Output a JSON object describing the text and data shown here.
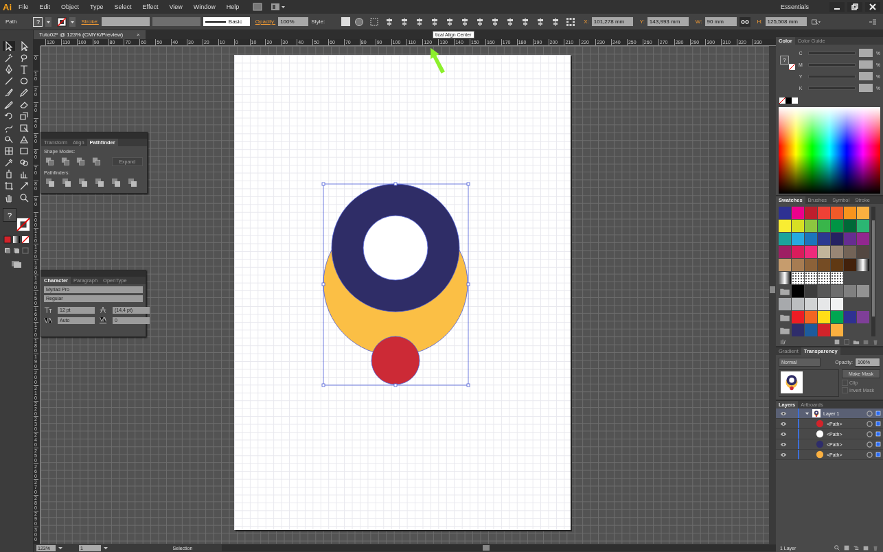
{
  "app": {
    "logo": "Ai",
    "menus": [
      "File",
      "Edit",
      "Object",
      "Type",
      "Select",
      "Effect",
      "View",
      "Window",
      "Help"
    ],
    "workspace": "Essentials"
  },
  "control_bar": {
    "selection": "Path",
    "fill_label": "?",
    "stroke_label": "Stroke:",
    "brush": "Basic",
    "opacity_label": "Opacity:",
    "opacity": "100%",
    "style_label": "Style:",
    "x_label": "X:",
    "x": "101,278 mm",
    "y_label": "Y:",
    "y": "143,993 mm",
    "w_label": "W:",
    "w": "90 mm",
    "h_label": "H:",
    "h": "125,508 mm"
  },
  "document_tab": {
    "title": "Tuto02* @ 123% (CMYK/Preview)",
    "close": "×"
  },
  "rulers": {
    "horizontal": [
      "120",
      "110",
      "100",
      "90",
      "80",
      "70",
      "60",
      "50",
      "40",
      "30",
      "20",
      "10",
      "0",
      "10",
      "20",
      "30",
      "40",
      "50",
      "60",
      "70",
      "80",
      "90",
      "100",
      "110",
      "120",
      "130",
      "140",
      "150",
      "160",
      "170",
      "180",
      "190",
      "200",
      "210",
      "220",
      "230",
      "240",
      "250",
      "260",
      "270",
      "280",
      "290",
      "300",
      "310",
      "320",
      "330"
    ],
    "vertical": [
      "0",
      "10",
      "20",
      "30",
      "40",
      "50",
      "60",
      "70",
      "80",
      "90",
      "100",
      "110",
      "120",
      "130",
      "140",
      "150",
      "160",
      "170",
      "180",
      "190",
      "200",
      "210",
      "220",
      "230",
      "240",
      "250",
      "260",
      "270",
      "280",
      "290",
      "300"
    ]
  },
  "tooltip": "tical Align Center",
  "toolbar": {
    "fill_label": "?"
  },
  "pathfinder_panel": {
    "tabs": [
      {
        "label": "Transform",
        "selected": false
      },
      {
        "label": "Align",
        "selected": false
      },
      {
        "label": "Pathfinder",
        "selected": true
      }
    ],
    "shape_modes_label": "Shape Modes:",
    "expand_button": {
      "label": "Expand",
      "disabled": true
    },
    "pathfinders_label": "Pathfinders:"
  },
  "character_panel": {
    "tabs": [
      {
        "label": "Character",
        "selected": true
      },
      {
        "label": "Paragraph",
        "selected": false
      },
      {
        "label": "OpenType",
        "selected": false
      }
    ],
    "font": "Myriad Pro",
    "style": "Regular",
    "size": "12 pt",
    "leading": "(14,4 pt)",
    "kerning": "Auto",
    "tracking": "0"
  },
  "color_panel": {
    "tabs": [
      {
        "label": "Color",
        "selected": true
      },
      {
        "label": "Color Guide",
        "selected": false
      }
    ],
    "fill_label": "?",
    "channels": [
      {
        "name": "C",
        "unit": "%",
        "level": 0
      },
      {
        "name": "M",
        "unit": "%",
        "level": 0
      },
      {
        "name": "Y",
        "unit": "%",
        "level": 0
      },
      {
        "name": "K",
        "unit": "%",
        "level": 0
      }
    ]
  },
  "swatches_panel": {
    "tabs": [
      {
        "label": "Swatches",
        "selected": true
      },
      {
        "label": "Brushes",
        "selected": false
      },
      {
        "label": "Symbol",
        "selected": false
      },
      {
        "label": "Stroke",
        "selected": false
      }
    ],
    "rows": [
      [
        {
          "kind": "color",
          "color": "#2e3192"
        },
        {
          "kind": "color",
          "color": "#ec008c"
        },
        {
          "kind": "color",
          "color": "#be1e2d"
        },
        {
          "kind": "color",
          "color": "#ef4136"
        },
        {
          "kind": "color",
          "color": "#f15a29"
        },
        {
          "kind": "color",
          "color": "#f7941d"
        },
        {
          "kind": "color",
          "color": "#fbb040"
        }
      ],
      [
        {
          "kind": "color",
          "color": "#f9ed32"
        },
        {
          "kind": "color",
          "color": "#d7df23"
        },
        {
          "kind": "color",
          "color": "#8dc63f"
        },
        {
          "kind": "color",
          "color": "#39b54a"
        },
        {
          "kind": "color",
          "color": "#009444"
        },
        {
          "kind": "color",
          "color": "#006838"
        },
        {
          "kind": "color",
          "color": "#2bb673"
        }
      ],
      [
        {
          "kind": "color",
          "color": "#1ba39c"
        },
        {
          "kind": "color",
          "color": "#27aae1"
        },
        {
          "kind": "color",
          "color": "#1c75bc"
        },
        {
          "kind": "color",
          "color": "#2b3990"
        },
        {
          "kind": "color",
          "color": "#262262"
        },
        {
          "kind": "color",
          "color": "#662d91"
        },
        {
          "kind": "color",
          "color": "#92278f"
        }
      ],
      [
        {
          "kind": "color",
          "color": "#9e1f63"
        },
        {
          "kind": "color",
          "color": "#da1c5c"
        },
        {
          "kind": "color",
          "color": "#ee2a7b"
        },
        {
          "kind": "color",
          "color": "#c2b59b"
        },
        {
          "kind": "color",
          "color": "#998675"
        },
        {
          "kind": "color",
          "color": "#736357"
        },
        {
          "kind": "color",
          "color": "#534741"
        }
      ],
      [
        {
          "kind": "color",
          "color": "#c69c6d"
        },
        {
          "kind": "color",
          "color": "#a67c52"
        },
        {
          "kind": "color",
          "color": "#8c6239"
        },
        {
          "kind": "color",
          "color": "#754c24"
        },
        {
          "kind": "color",
          "color": "#603913"
        },
        {
          "kind": "color",
          "color": "#42210b"
        },
        {
          "kind": "gradient"
        }
      ],
      [
        {
          "kind": "gradient"
        },
        {
          "kind": "pattern"
        },
        {
          "kind": "pattern"
        },
        {
          "kind": "pattern"
        },
        {
          "kind": "pattern"
        }
      ],
      [
        {
          "kind": "folder"
        },
        {
          "kind": "color",
          "color": "#000000"
        },
        {
          "kind": "color",
          "color": "#3c3c3c"
        },
        {
          "kind": "color",
          "color": "#575757"
        },
        {
          "kind": "color",
          "color": "#6d6d6d"
        },
        {
          "kind": "color",
          "color": "#808080"
        },
        {
          "kind": "color",
          "color": "#939393"
        }
      ],
      [
        {
          "kind": "color",
          "color": "#a7a9ac"
        },
        {
          "kind": "color",
          "color": "#bcbec0"
        },
        {
          "kind": "color",
          "color": "#d1d3d4"
        },
        {
          "kind": "color",
          "color": "#e6e7e8"
        },
        {
          "kind": "color",
          "color": "#f1f2f2"
        }
      ],
      [
        {
          "kind": "folder"
        },
        {
          "kind": "color",
          "color": "#ed1c24"
        },
        {
          "kind": "color",
          "color": "#f26522"
        },
        {
          "kind": "color",
          "color": "#ffde17"
        },
        {
          "kind": "color",
          "color": "#00a651"
        },
        {
          "kind": "color",
          "color": "#2e3192"
        },
        {
          "kind": "color",
          "color": "#7f3f98"
        }
      ],
      [
        {
          "kind": "folder"
        },
        {
          "kind": "color",
          "color": "#2e2d6b"
        },
        {
          "kind": "color",
          "color": "#1d5b9c"
        },
        {
          "kind": "color",
          "color": "#d2232a"
        },
        {
          "kind": "color",
          "color": "#fbb040"
        }
      ]
    ]
  },
  "transparency_panel": {
    "tabs": [
      {
        "label": "Gradient",
        "selected": false
      },
      {
        "label": "Transparency",
        "selected": true
      }
    ],
    "blend_mode": "Normal",
    "opacity_label": "Opacity:",
    "opacity": "100%",
    "make_mask": "Make Mask",
    "options": [
      {
        "label": "Clip",
        "checked": false
      },
      {
        "label": "Invert Mask",
        "checked": false
      }
    ]
  },
  "layers_panel": {
    "tabs": [
      {
        "label": "Layers",
        "selected": true
      },
      {
        "label": "Artboards",
        "selected": false
      }
    ],
    "layers": [
      {
        "name": "Layer 1",
        "expanded": true,
        "selected": true,
        "children": [
          {
            "name": "<Path>",
            "color": "#d2232a",
            "selected": false
          },
          {
            "name": "<Path>",
            "color": "#ffffff",
            "selected": false
          },
          {
            "name": "<Path>",
            "color": "#2e2d6b",
            "selected": false
          },
          {
            "name": "<Path>",
            "color": "#fbb040",
            "selected": false
          }
        ]
      }
    ]
  },
  "status_bar": {
    "zoom": "123%",
    "artboard": "1",
    "tool": "Selection",
    "layer_count": "1 Layer"
  }
}
